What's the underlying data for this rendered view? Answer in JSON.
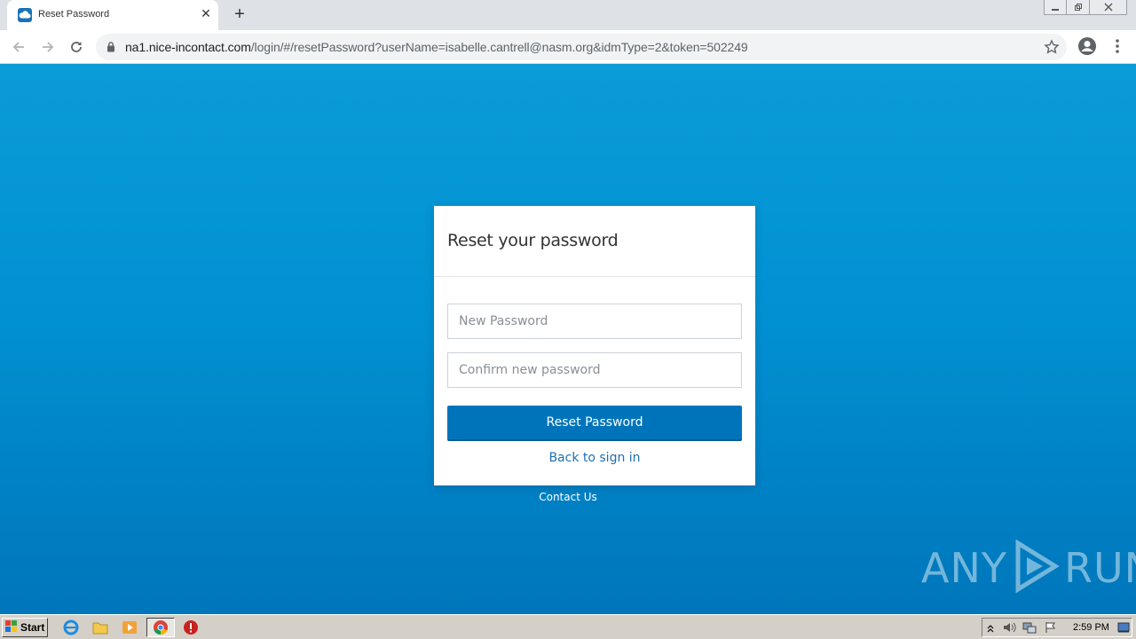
{
  "browser": {
    "tab_title": "Reset Password",
    "new_tab_label": "+",
    "url_host": "na1.nice-incontact.com",
    "url_path": "/login/#/resetPassword?userName=isabelle.cantrell@nasm.org&idmType=2&token=502249"
  },
  "form": {
    "title": "Reset your password",
    "new_password_placeholder": "New Password",
    "confirm_password_placeholder": "Confirm new password",
    "submit_label": "Reset Password",
    "back_link": "Back to sign in"
  },
  "footer": {
    "contact_label": "Contact Us"
  },
  "watermark": {
    "text_left": "ANY",
    "text_right": "RUN"
  },
  "taskbar": {
    "start_label": "Start",
    "clock": "2:59 PM"
  },
  "colors": {
    "page_top": "#0a9cd8",
    "page_bottom": "#0076bb",
    "button": "#0074bb",
    "link": "#1f6fb3"
  }
}
